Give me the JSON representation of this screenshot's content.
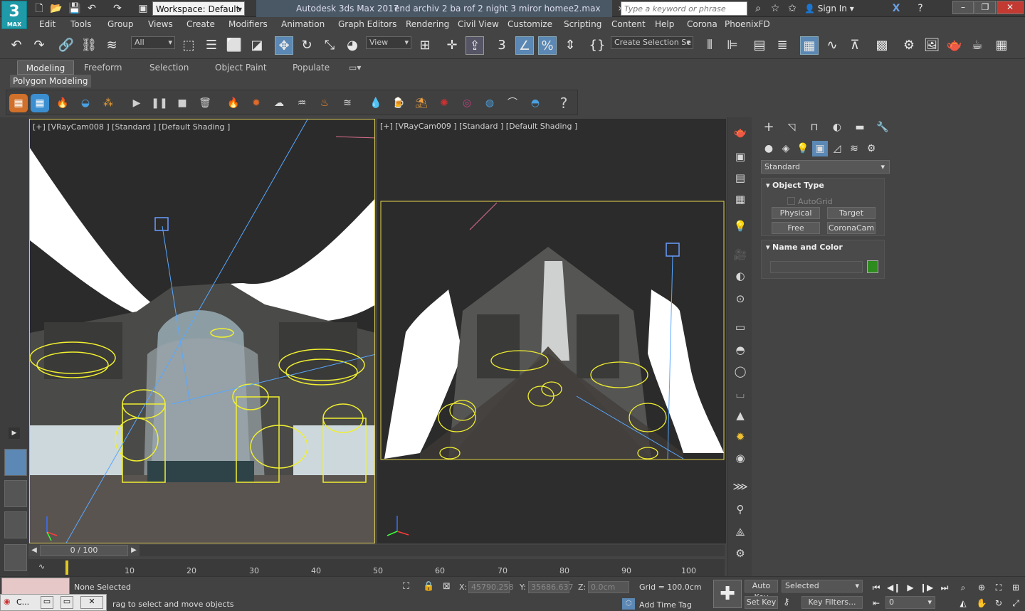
{
  "app": {
    "logo_text": "3",
    "logo_sub": "MAX",
    "title": "Autodesk 3ds Max 2017",
    "document": "end archiv 2 ba rof 2 night 3 miror homee2.max",
    "workspace": "Workspace: Default",
    "search_placeholder": "Type a keyword or phrase",
    "sign_in": "Sign In"
  },
  "menu": [
    "Edit",
    "Tools",
    "Group",
    "Views",
    "Create",
    "Modifiers",
    "Animation",
    "Graph Editors",
    "Rendering",
    "Civil View",
    "Customize",
    "Scripting",
    "Content",
    "Help",
    "Corona",
    "PhoenixFD"
  ],
  "main_toolbar": {
    "filter": "All",
    "ref_coord": "View",
    "selection_set": "Create Selection Se"
  },
  "ribbon": {
    "tabs": [
      "Modeling",
      "Freeform",
      "Selection",
      "Object Paint",
      "Populate"
    ],
    "sub_tab": "Polygon Modeling"
  },
  "viewports": {
    "left_label": "[+] [VRayCam008 ] [Standard ] [Default Shading ]",
    "right_label": "[+] [VRayCam009 ] [Standard ] [Default Shading ]"
  },
  "command_panel": {
    "dropdown": "Standard",
    "object_type_title": "Object Type",
    "autogrid": "AutoGrid",
    "buttons": [
      "Physical",
      "Target",
      "Free",
      "CoronaCam"
    ],
    "name_color_title": "Name and Color",
    "accent_color": "#2e8b1e"
  },
  "timeline": {
    "frame": "0 / 100",
    "ticks": [
      "10",
      "20",
      "30",
      "40",
      "50",
      "60",
      "70",
      "80",
      "90",
      "100"
    ]
  },
  "status": {
    "selection": "None Selected",
    "prompt": "rag to select and move objects",
    "x_label": "X:",
    "x_value": "45790.258",
    "y_label": "Y:",
    "y_value": "35686.637",
    "z_label": "Z:",
    "z_value": "0.0cm",
    "grid": "Grid = 100.0cm",
    "add_time_tag": "Add Time Tag",
    "auto_key": "Auto Key",
    "set_key": "Set Key",
    "selected": "Selected",
    "key_filters": "Key Filters...",
    "frame_field": "0",
    "taskbar_label": "C..."
  }
}
